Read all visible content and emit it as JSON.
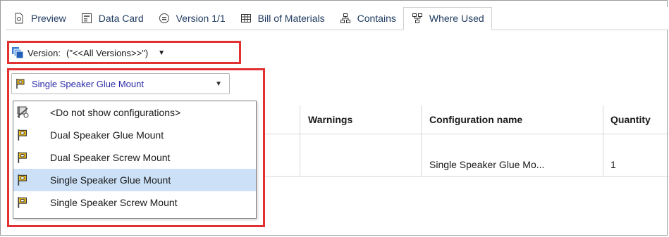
{
  "tabs": [
    {
      "label": "Preview",
      "icon": "preview-icon"
    },
    {
      "label": "Data Card",
      "icon": "data-card-icon"
    },
    {
      "label": "Version 1/1",
      "icon": "version-icon"
    },
    {
      "label": "Bill of Materials",
      "icon": "table-icon"
    },
    {
      "label": "Contains",
      "icon": "hierarchy-icon"
    },
    {
      "label": "Where Used",
      "icon": "where-used-icon",
      "active": true
    }
  ],
  "version": {
    "label": "Version:",
    "value": "(\"<<All Versions>>\")"
  },
  "configuration": {
    "selected": "Single Speaker Glue Mount",
    "options": [
      {
        "label": "<Do not show configurations>",
        "icon": "no-config-icon"
      },
      {
        "label": "Dual Speaker Glue Mount",
        "icon": "config-flag-icon"
      },
      {
        "label": "Dual Speaker Screw Mount",
        "icon": "config-flag-icon"
      },
      {
        "label": "Single Speaker Glue Mount",
        "icon": "config-flag-icon",
        "selected": true
      },
      {
        "label": "Single Speaker Screw Mount",
        "icon": "config-flag-icon"
      }
    ]
  },
  "grid": {
    "headers": {
      "warnings": "Warnings",
      "config_name": "Configuration name",
      "quantity": "Quantity"
    },
    "rows": [
      {
        "warnings": "",
        "config_name": "Single Speaker Glue Mo...",
        "quantity": "1"
      }
    ]
  },
  "colors": {
    "highlight": "#e03030",
    "selection": "#cce1f7",
    "link_text": "#2a2aa8"
  }
}
